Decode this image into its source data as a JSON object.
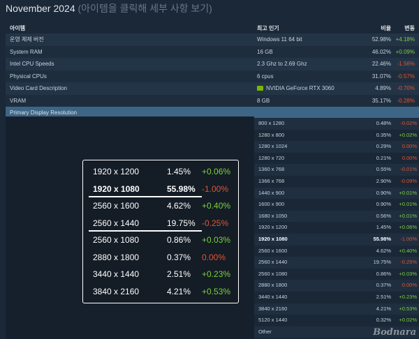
{
  "title": {
    "main": "November 2024",
    "sub": "(아이템을 클릭해 세부 사항 보기)"
  },
  "headers": {
    "item": "아이템",
    "popular": "최고 인기",
    "ratio": "비율",
    "change": "변동"
  },
  "rows": [
    {
      "item": "운영 체제 버전",
      "popular": "Windows 11 64 bit",
      "pct": "52.98%",
      "change": "+4.18%"
    },
    {
      "item": "System RAM",
      "popular": "16 GB",
      "pct": "46.02%",
      "change": "+0.09%"
    },
    {
      "item": "Intel CPU Speeds",
      "popular": "2.3 Ghz to 2.69 Ghz",
      "pct": "22.46%",
      "change": "-1.56%"
    },
    {
      "item": "Physical CPUs",
      "popular": "6 cpus",
      "pct": "31.07%",
      "change": "-0.57%"
    },
    {
      "item": "Video Card Description",
      "popular": "NVIDIA GeForce RTX 3060",
      "pct": "4.89%",
      "change": "-0.70%"
    },
    {
      "item": "VRAM",
      "popular": "8 GB",
      "pct": "35.17%",
      "change": "-0.28%"
    }
  ],
  "section_title": "Primary Display Resolution",
  "resolutions": [
    {
      "res": "800 x 1280",
      "pct": "0.48%",
      "change": "-0.02%"
    },
    {
      "res": "1280 x 800",
      "pct": "0.35%",
      "change": "+0.02%"
    },
    {
      "res": "1280 x 1024",
      "pct": "0.29%",
      "change": "0.00%"
    },
    {
      "res": "1280 x 720",
      "pct": "0.21%",
      "change": "0.00%"
    },
    {
      "res": "1360 x 768",
      "pct": "0.55%",
      "change": "-0.01%"
    },
    {
      "res": "1366 x 768",
      "pct": "2.90%",
      "change": "-0.09%"
    },
    {
      "res": "1440 x 900",
      "pct": "0.90%",
      "change": "+0.01%"
    },
    {
      "res": "1600 x 900",
      "pct": "0.90%",
      "change": "+0.01%"
    },
    {
      "res": "1680 x 1050",
      "pct": "0.56%",
      "change": "+0.01%"
    },
    {
      "res": "1920 x 1200",
      "pct": "1.45%",
      "change": "+0.06%"
    },
    {
      "res": "1920 x 1080",
      "pct": "55.98%",
      "change": "-1.00%"
    },
    {
      "res": "2560 x 1600",
      "pct": "4.62%",
      "change": "+0.40%"
    },
    {
      "res": "2560 x 1440",
      "pct": "19.75%",
      "change": "-0.25%"
    },
    {
      "res": "2560 x 1080",
      "pct": "0.86%",
      "change": "+0.03%"
    },
    {
      "res": "2880 x 1800",
      "pct": "0.37%",
      "change": "0.00%"
    },
    {
      "res": "3440 x 1440",
      "pct": "2.51%",
      "change": "+0.23%"
    },
    {
      "res": "3840 x 2160",
      "pct": "4.21%",
      "change": "+0.53%"
    },
    {
      "res": "5120 x 1440",
      "pct": "0.32%",
      "change": "+0.02%"
    },
    {
      "res": "Other",
      "pct": "",
      "change": ""
    }
  ],
  "highlight": [
    {
      "res": "1920 x 1200",
      "pct": "1.45%",
      "change": "+0.06%"
    },
    {
      "res": "1920 x 1080",
      "pct": "55.98%",
      "change": "-1.00%"
    },
    {
      "res": "2560 x 1600",
      "pct": "4.62%",
      "change": "+0.40%"
    },
    {
      "res": "2560 x 1440",
      "pct": "19.75%",
      "change": "-0.25%"
    },
    {
      "res": "2560 x 1080",
      "pct": "0.86%",
      "change": "+0.03%"
    },
    {
      "res": "2880 x 1800",
      "pct": "0.37%",
      "change": "0.00%"
    },
    {
      "res": "3440 x 1440",
      "pct": "2.51%",
      "change": "+0.23%"
    },
    {
      "res": "3840 x 2160",
      "pct": "4.21%",
      "change": "+0.53%"
    }
  ],
  "watermark": "Bodnara",
  "colors": {
    "positive": "#7bd13e",
    "negative": "#e3542f",
    "section": "#3c6586"
  }
}
